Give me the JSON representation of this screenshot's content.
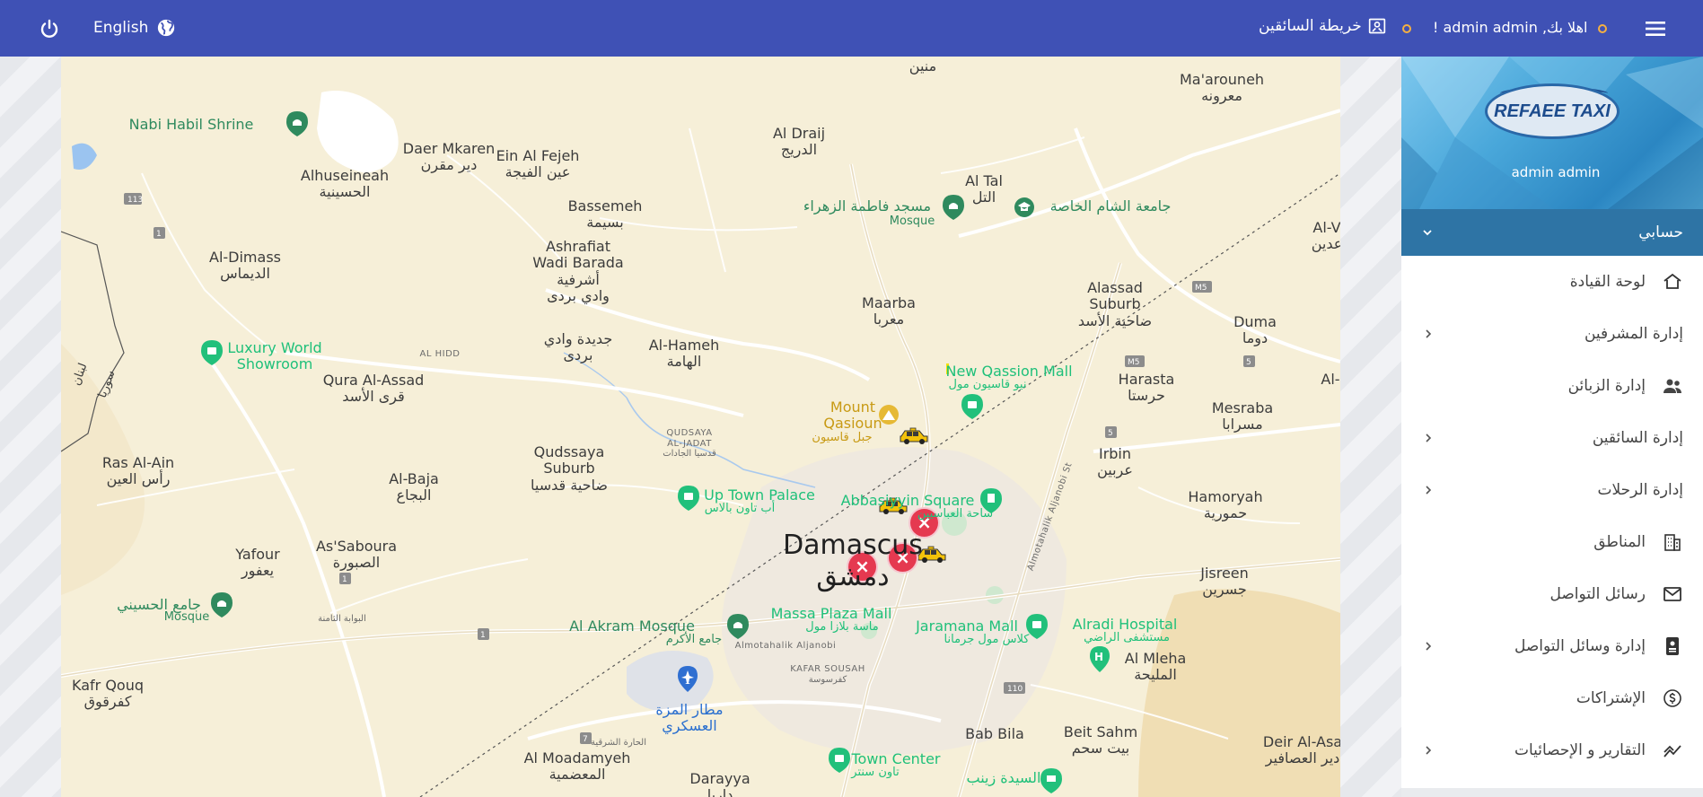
{
  "topbar": {
    "language": "English",
    "drivers_map": "خريطة السائقين",
    "greeting": "اهلا بك, admin admin !",
    "icons": {
      "power": "power-icon",
      "globe": "globe-icon",
      "map": "map-icon",
      "menu": "hamburger-menu-icon"
    },
    "colors": {
      "bar": "#3f51b5",
      "accent_dot": "#f5b041"
    }
  },
  "sidebar": {
    "logo_text": "REFAEE TAXI",
    "user_name": "admin admin",
    "account_label": "حسابي",
    "items": [
      {
        "label": "لوحة القيادة",
        "icon": "home-icon",
        "has_submenu": false
      },
      {
        "label": "إدارة المشرفين",
        "icon": "",
        "has_submenu": true
      },
      {
        "label": "إدارة الزبائن",
        "icon": "users-icon",
        "has_submenu": false
      },
      {
        "label": "إدارة السائقين",
        "icon": "",
        "has_submenu": true
      },
      {
        "label": "إدارة الرحلات",
        "icon": "",
        "has_submenu": true
      },
      {
        "label": "المناطق",
        "icon": "building-icon",
        "has_submenu": false
      },
      {
        "label": "رسائل التواصل",
        "icon": "envelope-icon",
        "has_submenu": false
      },
      {
        "label": "إدارة وسائل التواصل",
        "icon": "contact-card-icon",
        "has_submenu": true
      },
      {
        "label": "الإشتراكات",
        "icon": "dollar-coin-icon",
        "has_submenu": false
      },
      {
        "label": "التقارير و الإحصائيات",
        "icon": "chart-line-icon",
        "has_submenu": true
      }
    ],
    "colors": {
      "account_bar": "#2e74a5"
    }
  },
  "map": {
    "places": {
      "mnin": "منين",
      "maarouneh_en": "Ma'arouneh",
      "maarouneh_ar": "معرونه",
      "nabi_habil": "Nabi Habil Shrine",
      "daer_en": "Daer Mkaren",
      "daer_ar": "دير مقرن",
      "ein_en": "Ein Al Fejeh",
      "ein_ar": "عين الفيجة",
      "draij_en": "Al Draij",
      "draij_ar": "الدريج",
      "tal_en": "Al Tal",
      "tal_ar": "التل",
      "alhuseineah_en": "Alhuseineah",
      "alhuseineah_ar": "الحسينية",
      "bassemeh_en": "Bassemeh",
      "bassemeh_ar": "بسيمة",
      "zahraa_mosque_ar": "مسجد فاطمة الزهراء",
      "mosque_word": "Mosque",
      "sham_uni_ar": "جامعة الشام الخاصة",
      "al_v": "Al-V",
      "al_v_ar": "عدين",
      "dimass_en": "Al-Dimass",
      "dimass_ar": "الديماس",
      "ashrafiat_en1": "Ashrafiat",
      "ashrafiat_en2": "Wadi Barada",
      "ashrafiat_ar1": "أشرفية",
      "ashrafiat_ar2": "وادي بردى",
      "maarba_en": "Maarba",
      "maarba_ar": "معربا",
      "alassad_en1": "Alassad",
      "alassad_en2": "Suburb",
      "alassad_ar": "ضاحية الأسد",
      "duma_en": "Duma",
      "duma_ar": "دوما",
      "luxury_en1": "Luxury World",
      "luxury_en2": "Showroom",
      "al_hidd": "AL HIDD",
      "qura_en": "Qura Al-Assad",
      "qura_ar": "قرى الأسد",
      "jdeideh_ar1": "جديدة وادي",
      "jdeideh_ar2": "بردى",
      "hameh_en": "Al-Hameh",
      "hameh_ar": "الهامة",
      "qassion_mall_en": "New Qassion Mall",
      "qassion_mall_ar": "نيو قاسيون مول",
      "harasta_en": "Harasta",
      "harasta_ar": "حرستا",
      "al_right": "Al-",
      "mesraba_en": "Mesraba",
      "mesraba_ar": "مسرابا",
      "mount_en1": "Mount",
      "mount_en2": "Qasioun",
      "mount_ar": "جبل قاسيون",
      "qudsaya_jadat1": "QUDSAYA",
      "qudsaya_jadat2": "AL-JADAT",
      "qudsaya_jadat_ar": "قدسيا الجادات",
      "qudssaya_en1": "Qudssaya",
      "qudssaya_en2": "Suburb",
      "qudssaya_ar": "ضاحية قدسيا",
      "irbin_en": "Irbin",
      "irbin_ar": "عربين",
      "ras_en": "Ras Al-Ain",
      "ras_ar": "رأس العين",
      "baja_en": "Al-Baja",
      "baja_ar": "البجاع",
      "uptown_en": "Up Town Palace",
      "uptown_ar": "أب تاون بالاس",
      "abbasiyin_en": "Abbasiyyin Square",
      "abbasiyin_ar": "ساحة العباسيين",
      "hamoryah_en": "Hamoryah",
      "hamoryah_ar": "حمورية",
      "yafour_en": "Yafour",
      "yafour_ar": "يعفور",
      "saboura_en": "As'Saboura",
      "saboura_ar": "الصبورة",
      "damascus_en": "Damascus",
      "damascus_ar": "دمشق",
      "jisreen_en": "Jisreen",
      "jisreen_ar": "جسرين",
      "husseini_ar": "جامع الحسيني",
      "bawwaba": "البوابة الثامنة",
      "akram_en": "Al Akram Mosque",
      "akram_ar": "جامع الأكرم",
      "massa_en": "Massa Plaza Mall",
      "massa_ar": "ماسة بلازا مول",
      "jaramana_en": "Jaramana Mall",
      "jaramana_ar": "كلاس مول جرمانا",
      "alradi_en": "Alradi Hospital",
      "alradi_ar": "مستشفى الراضي",
      "mleha_en": "Al Mleha",
      "mleha_ar": "المليحة",
      "jlbn_street": "Almotahalik Aljanobi St",
      "jlbn_street2": "Almotahalik Aljanobi",
      "kafar_en": "KAFAR SOUSAH",
      "kafar_ar": "كفرسوسة",
      "kafr_en": "Kafr Qouq",
      "kafr_ar": "كفرقوق",
      "mezzeh_ar1": "مطار المزة",
      "mezzeh_ar2": "العسكري",
      "sharqieh": "الحارة الشرقية",
      "moadamyeh_en": "Al Moadamyeh",
      "moadamyeh_ar": "المعضمية",
      "daraya_en": "Darayya",
      "daraya_ar": "داريا",
      "town_center_en": "Town Center",
      "town_center_ar": "تاون سنتر",
      "zainab_ar": "السيدة زينب",
      "babbila": "Bab Bila",
      "beit_en": "Beit Sahm",
      "beit_ar": "بيت سحم",
      "deir_en": "Deir Al-Asa",
      "deir_ar": "دير العصافير",
      "syria_lebanon_1": "لبنان",
      "syria_lebanon_2": "سوريا"
    },
    "road_numbers": [
      "113",
      "1",
      "1",
      "1",
      "7",
      "110",
      "M5",
      "M5",
      "5",
      "5"
    ],
    "markers": {
      "taxis": 3,
      "unavailable": 3
    }
  }
}
